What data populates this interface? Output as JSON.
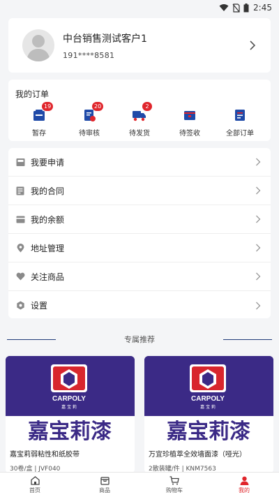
{
  "status_bar": {
    "time": "2:45"
  },
  "profile": {
    "name": "中台销售测试客户1",
    "phone": "191****8581"
  },
  "orders": {
    "title": "我的订单",
    "items": [
      {
        "label": "暂存",
        "badge": "19",
        "icon": "draft-icon"
      },
      {
        "label": "待审核",
        "badge": "20",
        "icon": "review-icon"
      },
      {
        "label": "待发货",
        "badge": "2",
        "icon": "truck-icon"
      },
      {
        "label": "待签收",
        "badge": "",
        "icon": "receive-icon"
      },
      {
        "label": "全部订单",
        "badge": "",
        "icon": "all-orders-icon"
      }
    ]
  },
  "menu": {
    "items": [
      {
        "label": "我要申请",
        "icon": "inbox-icon"
      },
      {
        "label": "我的合同",
        "icon": "contract-icon"
      },
      {
        "label": "我的余额",
        "icon": "wallet-icon"
      },
      {
        "label": "地址管理",
        "icon": "location-icon"
      },
      {
        "label": "关注商品",
        "icon": "heart-icon"
      },
      {
        "label": "设置",
        "icon": "gear-icon"
      }
    ]
  },
  "recommend": {
    "title": "专属推荐",
    "products": [
      {
        "name": "嘉宝莉弱粘性和纸胶带",
        "meta": "30卷/盒 | JVF040",
        "brand_en": "CARPOLY",
        "brand_cn_small": "嘉 宝 莉",
        "banner": "嘉宝莉漆"
      },
      {
        "name": "万宜珍植萃全效墙面漆（哑光）",
        "meta": "2散装罐/件 | KNM7563",
        "brand_en": "CARPOLY",
        "brand_cn_small": "嘉 宝 莉",
        "banner": "嘉宝莉漆"
      }
    ]
  },
  "tabbar": {
    "tabs": [
      {
        "label": "首页",
        "icon": "home-icon"
      },
      {
        "label": "商品",
        "icon": "goods-icon"
      },
      {
        "label": "购物车",
        "icon": "cart-icon"
      },
      {
        "label": "我的",
        "icon": "user-icon",
        "active": true
      }
    ]
  },
  "colors": {
    "accent": "#e0262c",
    "brand_blue": "#1f4aa8",
    "product_bg": "#3b2a86"
  }
}
